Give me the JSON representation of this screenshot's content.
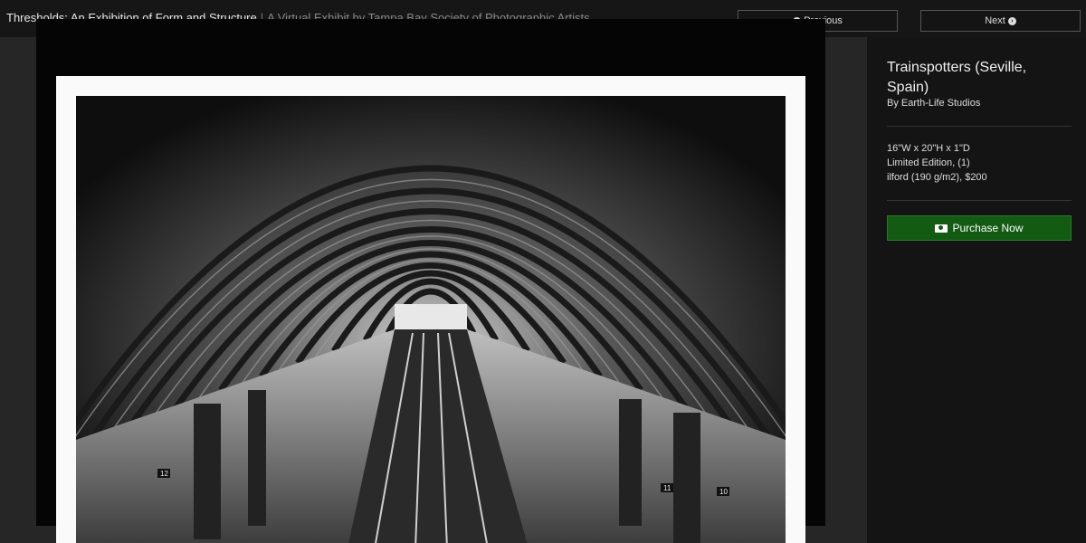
{
  "header": {
    "title": "Thresholds: An Exhibition of Form and Structure",
    "separator": "|",
    "subtitle": "A Virtual Exhibit by Tampa Bay Society of Photographic Artists",
    "prev_label": "Previous",
    "next_label": "Next"
  },
  "artwork": {
    "title": "Trainspotters (Seville, Spain)",
    "artist": "By Earth-Life Studios",
    "dimensions": "16\"W x 20\"H x 1\"D",
    "edition": "Limited Edition, (1)",
    "medium_price": "ilford (190 g/m2), $200",
    "purchase_label": "Purchase Now",
    "photo_signs": [
      "12",
      "11",
      "10"
    ]
  },
  "icons": {
    "prev": "chevron-circle-left-icon",
    "next": "chevron-circle-right-icon",
    "purchase": "money-icon"
  },
  "colors": {
    "purchase_button": "#135a13",
    "header_bg": "#161616",
    "sidebar_bg": "#141414"
  }
}
